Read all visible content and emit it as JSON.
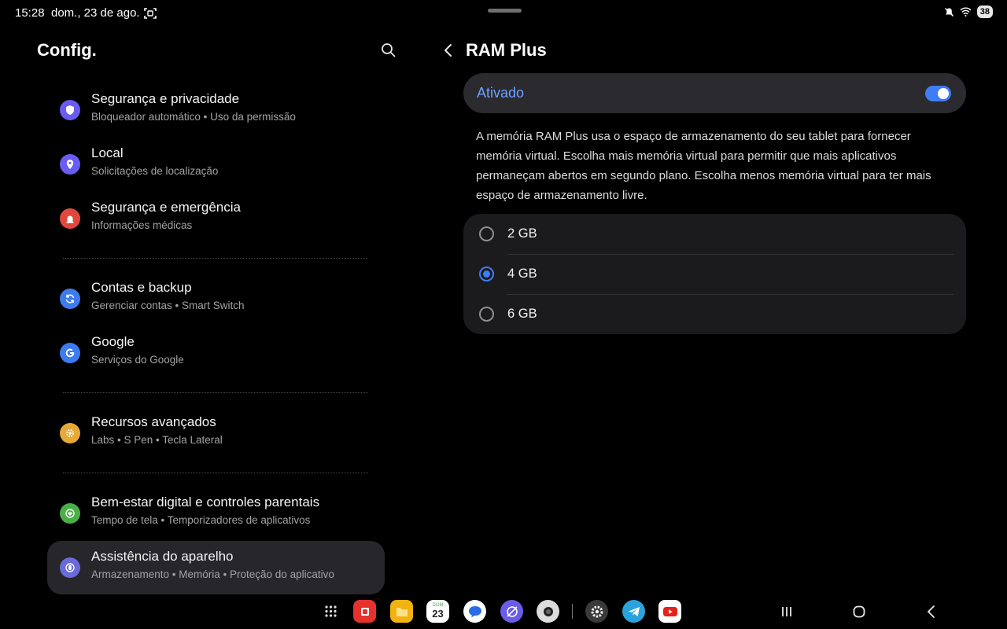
{
  "status_bar": {
    "time": "15:28",
    "date": "dom., 23 de ago.",
    "battery": "38",
    "icons": [
      "screenshot-icon",
      "mute-icon",
      "wifi-icon"
    ]
  },
  "left_panel": {
    "title": "Config.",
    "search_icon": "search-icon",
    "items": [
      {
        "title": "Segurança e privacidade",
        "subtitle": "Bloqueador automático  •  Uso da permissão",
        "icon": "shield-icon",
        "color": "#6a5cf0"
      },
      {
        "title": "Local",
        "subtitle": "Solicitações de localização",
        "icon": "location-pin-icon",
        "color": "#6a5cf0"
      },
      {
        "title": "Segurança e emergência",
        "subtitle": "Informações médicas",
        "icon": "emergency-siren-icon",
        "color": "#e0483e"
      },
      {
        "title": "Contas e backup",
        "subtitle": "Gerenciar contas  •  Smart Switch",
        "icon": "sync-icon",
        "color": "#3d7bf0"
      },
      {
        "title": "Google",
        "subtitle": "Serviços do Google",
        "icon": "google-icon",
        "color": "#3d7bf0"
      },
      {
        "title": "Recursos avançados",
        "subtitle": "Labs  •  S Pen  •  Tecla Lateral",
        "icon": "gear-plus-icon",
        "color": "#e6a936"
      },
      {
        "title": "Bem-estar digital e controles parentais",
        "subtitle": "Tempo de tela  •  Temporizadores de aplicativos",
        "icon": "heart-icon",
        "color": "#4ab046"
      },
      {
        "title": "Assistência do aparelho",
        "subtitle": "Armazenamento  •  Memória  •  Proteção do aplicativo",
        "icon": "device-care-icon",
        "color": "#6a6ad8"
      }
    ]
  },
  "right_panel": {
    "title": "RAM Plus",
    "toggle_label": "Ativado",
    "toggle_on": true,
    "description": "A memória RAM Plus usa o espaço de armazenamento do seu tablet para fornecer memória virtual. Escolha mais memória virtual para permitir que mais aplicativos permaneçam abertos em segundo plano. Escolha menos memória virtual para ter mais espaço de armazenamento livre.",
    "options": [
      {
        "label": "2 GB",
        "selected": false
      },
      {
        "label": "4 GB",
        "selected": true
      },
      {
        "label": "6 GB",
        "selected": false
      }
    ],
    "accent": "#3f7df5"
  },
  "taskbar": {
    "calendar_day": "23",
    "calendar_weekday": "DOM",
    "apps": [
      "app-drawer-icon",
      "notes-app-icon",
      "my-files-icon",
      "calendar-icon",
      "messages-icon",
      "browser-icon",
      "camera-icon",
      "settings-icon",
      "telegram-icon",
      "youtube-icon"
    ],
    "nav": [
      "recents-icon",
      "home-icon",
      "back-icon"
    ]
  }
}
